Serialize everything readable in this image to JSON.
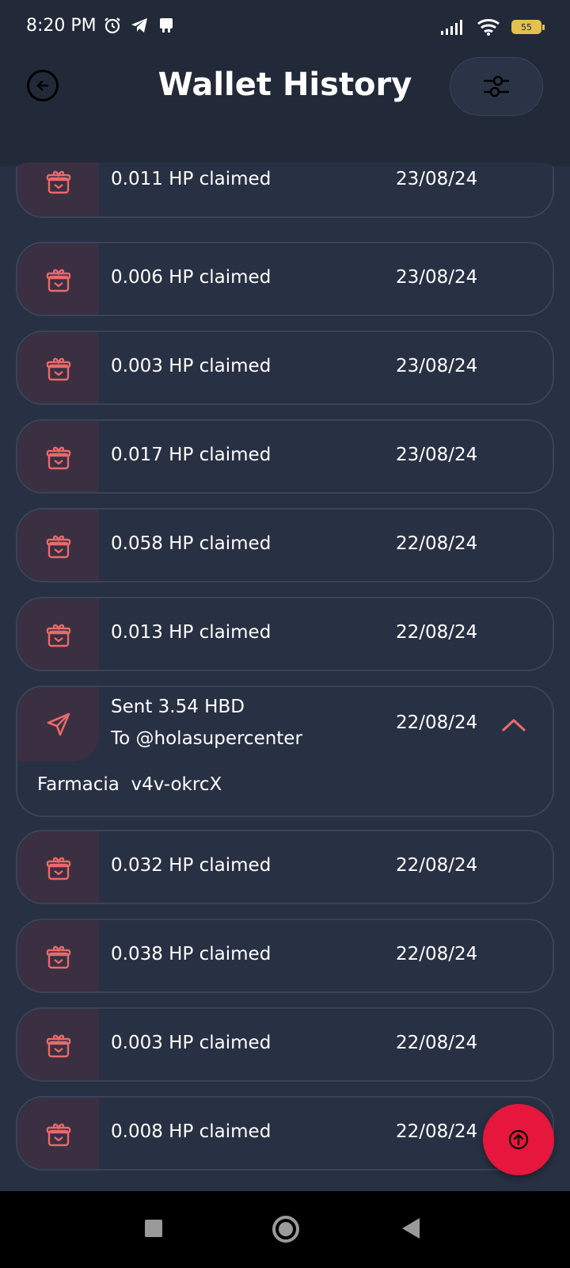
{
  "status_bar": {
    "time": "8:20 PM",
    "battery": "55",
    "icons_left": [
      "alarm-icon",
      "telegram-icon",
      "notification-icon"
    ],
    "icons_right": [
      "signal-icon",
      "wifi-icon",
      "battery-icon"
    ]
  },
  "header": {
    "title": "Wallet History",
    "back_icon": "back-arrow-icon",
    "filter_icon": "sliders-icon"
  },
  "colors": {
    "background": "#283043",
    "header_bg": "#222a39",
    "accent": "#e6163c",
    "icon_tint": "#e86a6a",
    "icon_box": "#3a3042"
  },
  "transactions": [
    {
      "label": "0.011 HP claimed",
      "date": "23/08/24",
      "icon": "gift-icon"
    },
    {
      "label": "0.006 HP claimed",
      "date": "23/08/24",
      "icon": "gift-icon"
    },
    {
      "label": "0.003 HP claimed",
      "date": "23/08/24",
      "icon": "gift-icon"
    },
    {
      "label": "0.017 HP claimed",
      "date": "23/08/24",
      "icon": "gift-icon"
    },
    {
      "label": "0.058 HP claimed",
      "date": "22/08/24",
      "icon": "gift-icon"
    },
    {
      "label": "0.013 HP claimed",
      "date": "22/08/24",
      "icon": "gift-icon"
    }
  ],
  "expanded_transaction": {
    "line1": "Sent 3.54 HBD",
    "line2": "To @holasupercenter",
    "date": "22/08/24",
    "memo": "Farmacia  v4v-okrcX",
    "icon": "send-icon"
  },
  "transactions_after": [
    {
      "label": "0.032 HP claimed",
      "date": "22/08/24",
      "icon": "gift-icon"
    },
    {
      "label": "0.038 HP claimed",
      "date": "22/08/24",
      "icon": "gift-icon"
    },
    {
      "label": "0.003 HP claimed",
      "date": "22/08/24",
      "icon": "gift-icon"
    },
    {
      "label": "0.008 HP claimed",
      "date": "22/08/24",
      "icon": "gift-icon"
    }
  ],
  "fab": {
    "icon": "scroll-up-icon"
  },
  "nav_bar": {
    "icons": [
      "recents-icon",
      "home-icon",
      "back-icon"
    ]
  }
}
